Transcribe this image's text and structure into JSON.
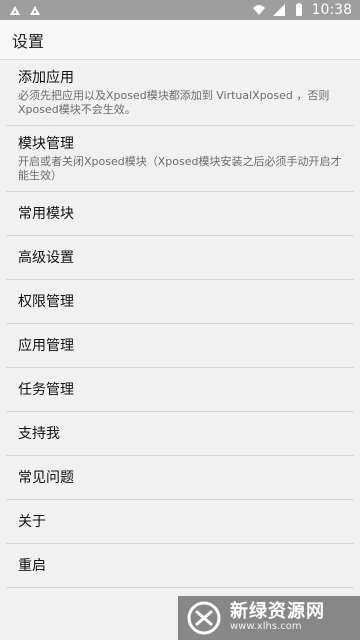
{
  "status_bar": {
    "time": "10:38"
  },
  "toolbar": {
    "title": "设置"
  },
  "items": [
    {
      "title": "添加应用",
      "summary": "必须先把应用以及Xposed模块都添加到 VirtualXposed ，否则Xposed模块不会生效。"
    },
    {
      "title": "模块管理",
      "summary": "开启或者关闭Xposed模块（Xposed模块安装之后必须手动开启才能生效）"
    },
    {
      "title": "常用模块"
    },
    {
      "title": "高级设置"
    },
    {
      "title": "权限管理"
    },
    {
      "title": "应用管理"
    },
    {
      "title": "任务管理"
    },
    {
      "title": "支持我"
    },
    {
      "title": "常见问题"
    },
    {
      "title": "关于"
    },
    {
      "title": "重启"
    }
  ],
  "watermark": {
    "name": "新绿资源网",
    "url": "www.xlhs.com"
  }
}
